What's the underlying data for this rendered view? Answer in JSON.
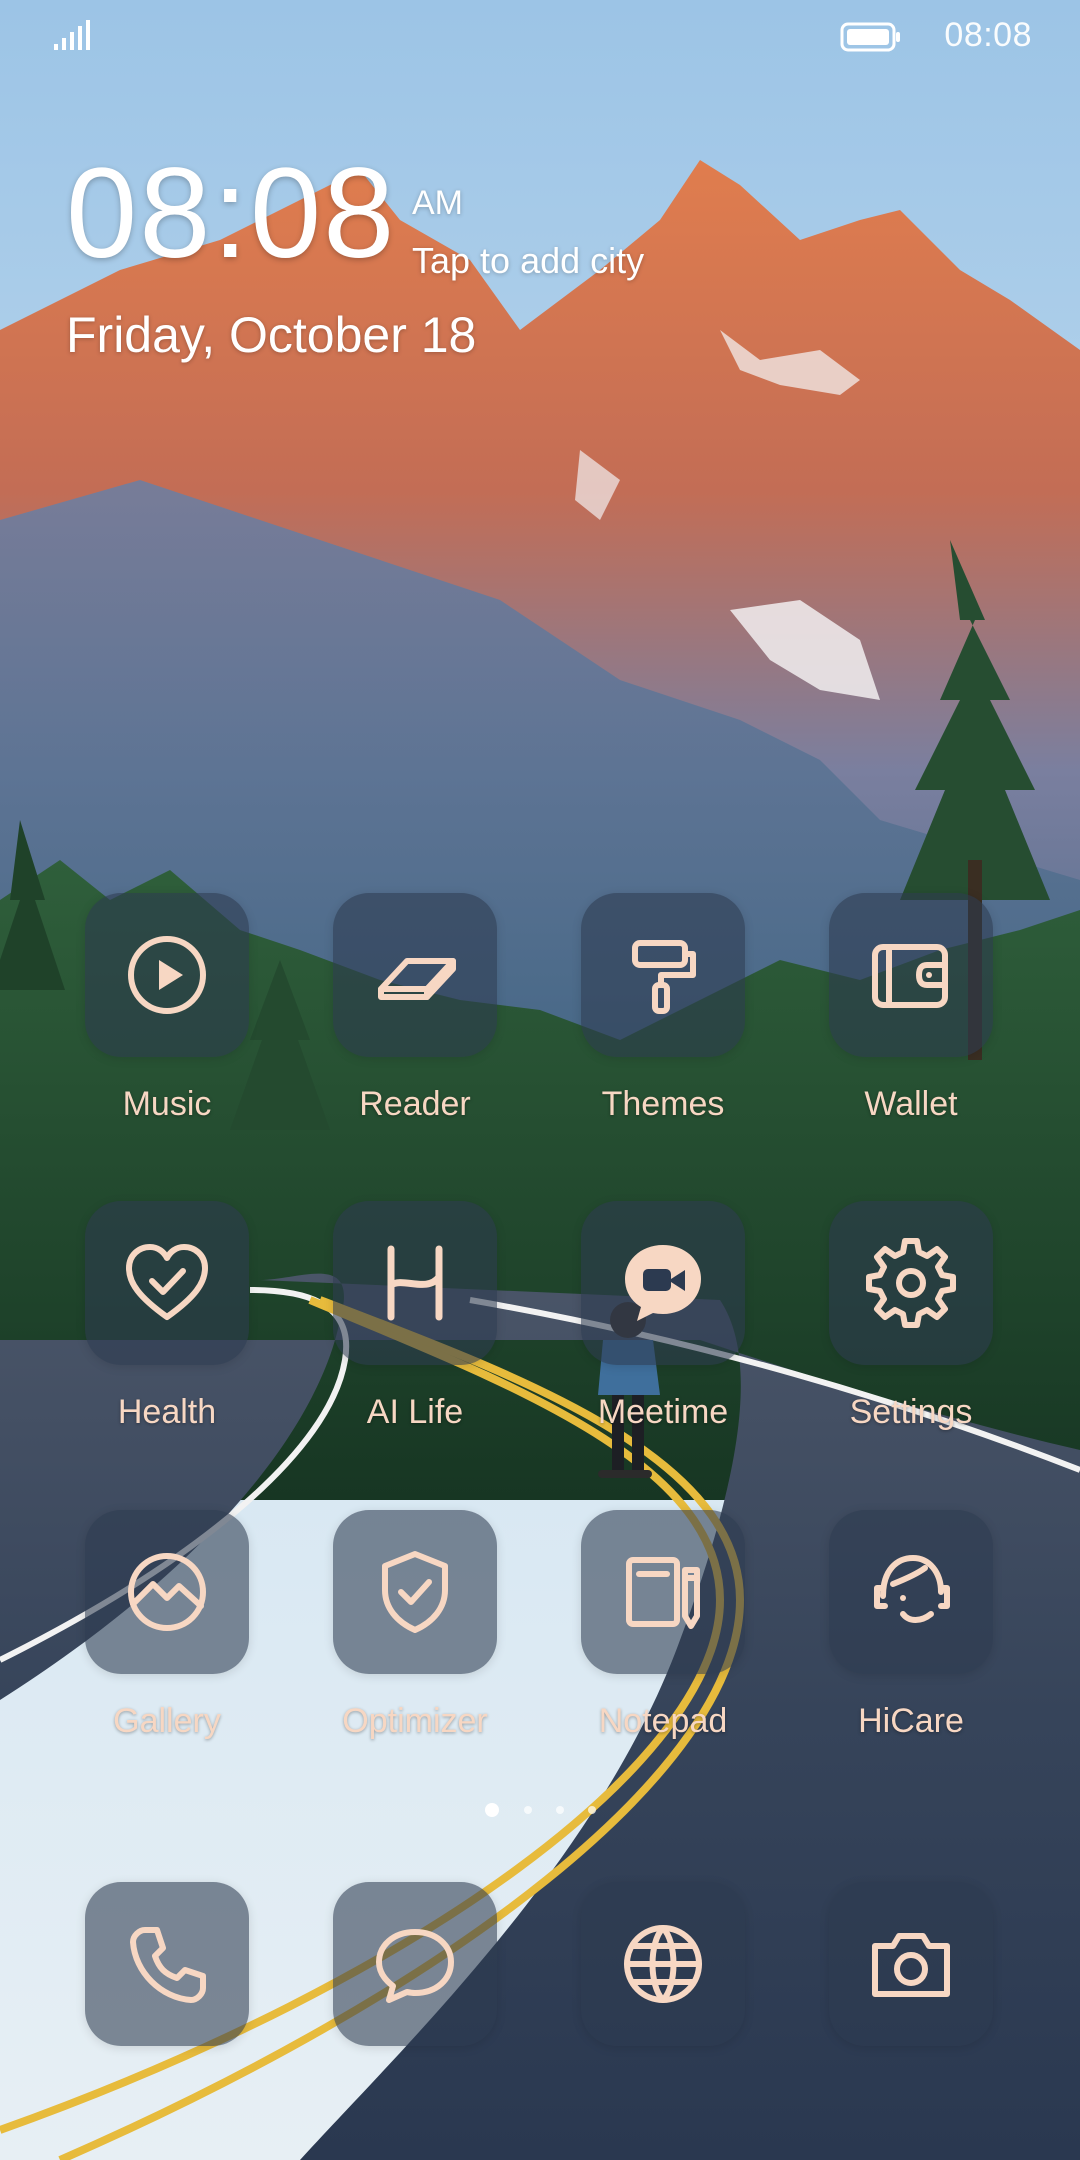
{
  "status_bar": {
    "time": "08:08",
    "signal_icon": "signal-bars-icon",
    "battery_icon": "battery-icon"
  },
  "clock_widget": {
    "time": "08:08",
    "am_pm": "AM",
    "city_prompt": "Tap to add city",
    "date": "Friday, October 18"
  },
  "apps": [
    {
      "label": "Music",
      "icon": "play-circle-icon"
    },
    {
      "label": "Reader",
      "icon": "book-eraser-icon"
    },
    {
      "label": "Themes",
      "icon": "paint-roller-icon"
    },
    {
      "label": "Wallet",
      "icon": "wallet-icon"
    },
    {
      "label": "Health",
      "icon": "heart-check-icon"
    },
    {
      "label": "AI Life",
      "icon": "ai-life-icon"
    },
    {
      "label": "Meetime",
      "icon": "video-chat-icon"
    },
    {
      "label": "Settings",
      "icon": "gear-icon"
    },
    {
      "label": "Gallery",
      "icon": "gallery-icon"
    },
    {
      "label": "Optimizer",
      "icon": "shield-check-icon"
    },
    {
      "label": "Notepad",
      "icon": "notepad-icon"
    },
    {
      "label": "HiCare",
      "icon": "headset-icon"
    }
  ],
  "page_indicator": {
    "total": 4,
    "active": 1
  },
  "dock": [
    {
      "icon": "phone-icon"
    },
    {
      "icon": "message-icon"
    },
    {
      "icon": "globe-icon"
    },
    {
      "icon": "camera-icon"
    }
  ],
  "colors": {
    "icon_accent": "#F7D7C3",
    "tile_background": "#2C3A50"
  }
}
